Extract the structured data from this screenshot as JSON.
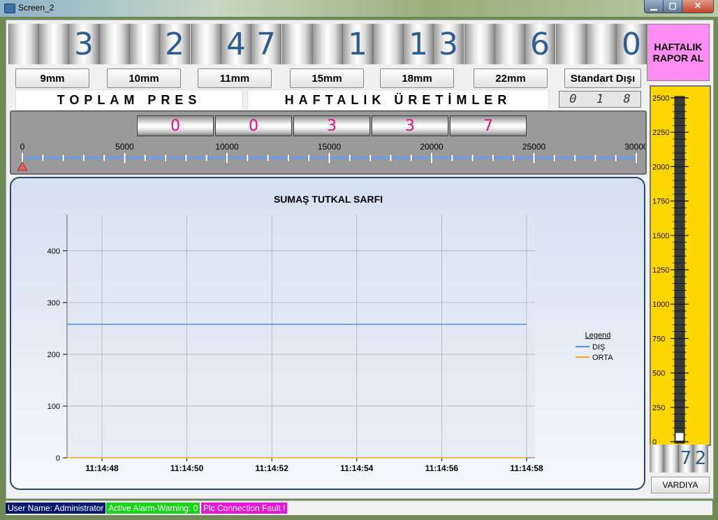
{
  "window": {
    "title": "Screen_2",
    "minimize": "▁",
    "maximize": "▢",
    "close": "✕"
  },
  "counters": [
    {
      "digits": [
        "",
        "",
        "3"
      ]
    },
    {
      "digits": [
        "",
        "",
        "2"
      ]
    },
    {
      "digits": [
        "",
        "4",
        "7"
      ]
    },
    {
      "digits": [
        "",
        "",
        "1"
      ]
    },
    {
      "digits": [
        "",
        "1",
        "3"
      ]
    },
    {
      "digits": [
        "",
        "",
        "6"
      ]
    },
    {
      "digits": [
        "",
        "",
        "0"
      ]
    }
  ],
  "size_buttons": [
    "9mm",
    "10mm",
    "11mm",
    "15mm",
    "18mm",
    "22mm",
    "Standart Dışı"
  ],
  "labels": {
    "toplam": "TOPLAM   PRES",
    "haftalik": "HAFTALIK   ÜRETİMLER"
  },
  "small_counter": [
    "0",
    "1",
    "8"
  ],
  "haftalik_button": "HAFTALIK RAPOR AL",
  "total_counter": [
    "0",
    "0",
    "3",
    "3",
    "7"
  ],
  "slider": {
    "ticks": [
      "0",
      "5000",
      "10000",
      "15000",
      "20000",
      "25000",
      "30000"
    ],
    "value": 0,
    "max": 30000
  },
  "chart_data": {
    "type": "line",
    "title": "SUMAŞ TUTKAL SARFI",
    "x": [
      "11:14:48",
      "11:14:50",
      "11:14:52",
      "11:14:54",
      "11:14:56",
      "11:14:58"
    ],
    "ylim": [
      0,
      470
    ],
    "yticks": [
      0,
      100,
      200,
      300,
      400
    ],
    "legend_title": "Legend",
    "legend_position": "right",
    "grid": true,
    "series": [
      {
        "name": "DIŞ",
        "color": "#4a90e2",
        "values": [
          258,
          258,
          258,
          258,
          258,
          258
        ]
      },
      {
        "name": "ORTA",
        "color": "#f5a623",
        "values": [
          0,
          0,
          0,
          0,
          0,
          0
        ]
      }
    ]
  },
  "gauge": {
    "ticks": [
      "2500",
      "2250",
      "2000",
      "1750",
      "1500",
      "1250",
      "1000",
      "750",
      "500",
      "250",
      "0"
    ],
    "value": 0,
    "counter": [
      "",
      "",
      "7",
      "2"
    ],
    "color": "#ffd700"
  },
  "vardiya_button": "VARDIYA",
  "status": {
    "user": "User Name: Administrator",
    "alarm": "Active Alarm-Warning: 0",
    "plc": "Plc Connection Fault !"
  }
}
